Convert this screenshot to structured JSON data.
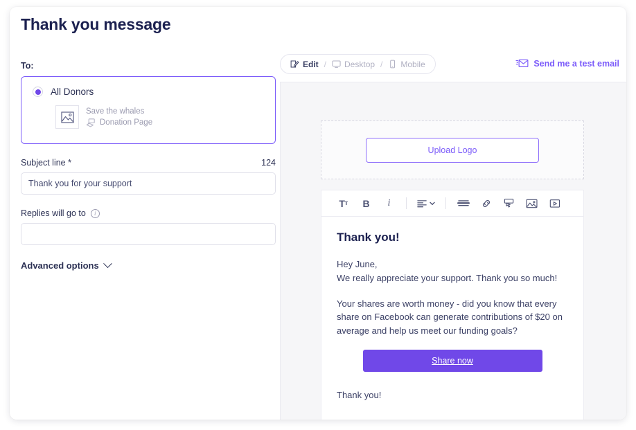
{
  "page": {
    "title": "Thank you message"
  },
  "form": {
    "to_label": "To:",
    "recipient": {
      "option_label": "All Donors",
      "selected": true,
      "campaign_name": "Save the whales",
      "page_type": "Donation Page"
    },
    "subject": {
      "label": "Subject line *",
      "char_count": "124",
      "value": "Thank you for your support",
      "placeholder": "Subject line"
    },
    "replies": {
      "label": "Replies will go to",
      "value": "",
      "placeholder": ""
    },
    "advanced_options_label": "Advanced options"
  },
  "toolbar": {
    "view_modes": {
      "edit": "Edit",
      "sep1": "/",
      "desktop": "Desktop",
      "sep2": "/",
      "mobile": "Mobile",
      "active": "Edit"
    },
    "test_email_label": "Send me a test email"
  },
  "preview": {
    "upload_logo_label": "Upload Logo",
    "editor_tools": [
      {
        "name": "text-size-icon",
        "label": "Tт"
      },
      {
        "name": "bold-icon",
        "label": "B"
      },
      {
        "name": "italic-icon",
        "label": "i"
      },
      {
        "name": "align-icon",
        "label": "align"
      },
      {
        "name": "horizontal-rule-icon",
        "label": "divider"
      },
      {
        "name": "link-icon",
        "label": "link"
      },
      {
        "name": "button-icon",
        "label": "button"
      },
      {
        "name": "image-icon",
        "label": "image"
      },
      {
        "name": "video-icon",
        "label": "video"
      }
    ],
    "email": {
      "heading": "Thank you!",
      "greeting_line1": "Hey June,",
      "greeting_line2": "We really appreciate your support. Thank you so much!",
      "body_paragraph": "Your shares are worth money - did you know that every share on Facebook can generate contributions of $20 on average and help us meet our funding goals?",
      "cta_label": "Share now",
      "closing": "Thank you!"
    }
  },
  "colors": {
    "accent": "#7048e8",
    "accent_light": "#7c5cfa",
    "text_dark": "#1c2150",
    "text_muted": "#9b9bb0",
    "panel_bg": "#f6f6f8"
  }
}
